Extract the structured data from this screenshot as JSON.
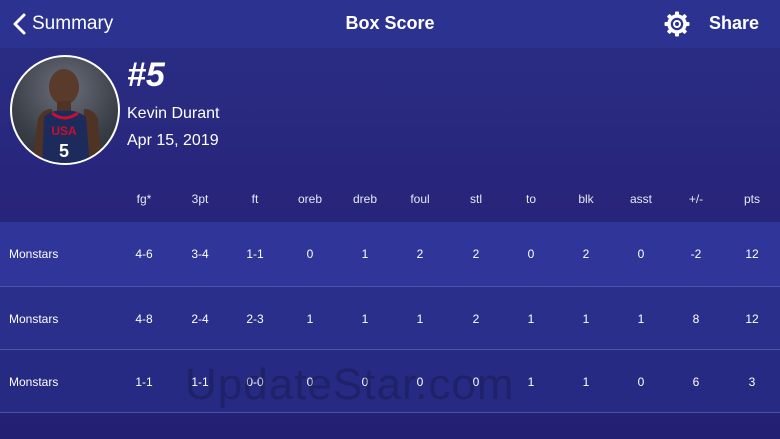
{
  "nav": {
    "back_label": "Summary",
    "title": "Box Score",
    "share_label": "Share",
    "back_icon": "chevron-left-icon",
    "settings_icon": "gear-icon"
  },
  "player": {
    "number": "#5",
    "name": "Kevin Durant",
    "date": "Apr 15, 2019"
  },
  "columns": [
    "fg*",
    "3pt",
    "ft",
    "oreb",
    "dreb",
    "foul",
    "stl",
    "to",
    "blk",
    "asst",
    "+/-",
    "pts"
  ],
  "rows": [
    {
      "team": "Monstars",
      "values": [
        "4-6",
        "3-4",
        "1-1",
        "0",
        "1",
        "2",
        "2",
        "0",
        "2",
        "0",
        "-2",
        "12"
      ]
    },
    {
      "team": "Monstars",
      "values": [
        "4-8",
        "2-4",
        "2-3",
        "1",
        "1",
        "1",
        "2",
        "1",
        "1",
        "1",
        "8",
        "12"
      ]
    },
    {
      "team": "Monstars",
      "values": [
        "1-1",
        "1-1",
        "0-0",
        "0",
        "0",
        "0",
        "0",
        "1",
        "1",
        "0",
        "6",
        "3"
      ]
    }
  ],
  "watermark": "UpdateStar.com",
  "colors": {
    "background": "#28267c",
    "navbar": "#2c3290",
    "text": "#ffffff"
  }
}
